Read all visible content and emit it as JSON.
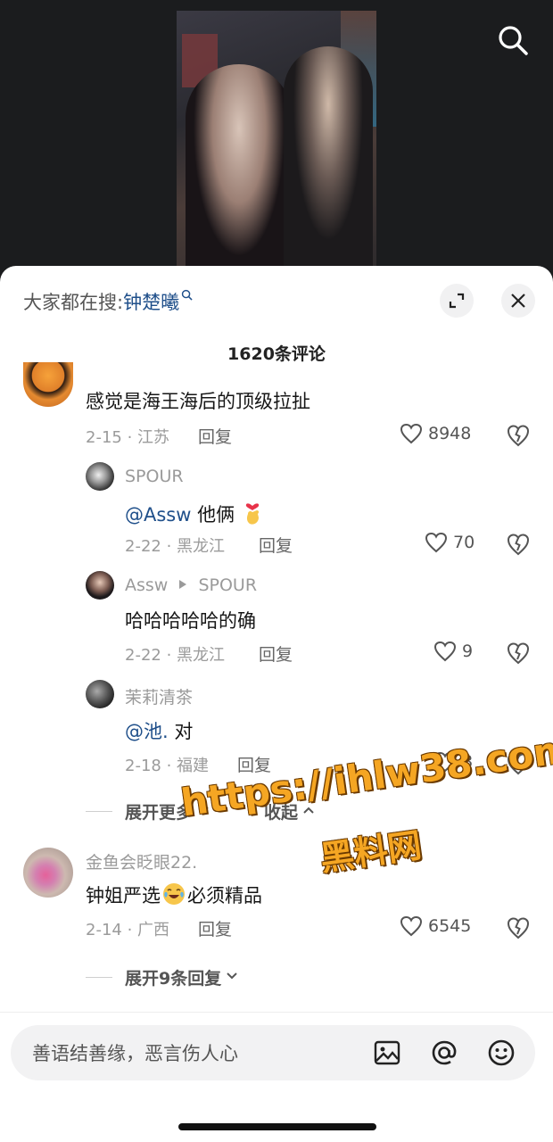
{
  "video": {
    "search_icon": "search-icon"
  },
  "hot_search": {
    "prefix": "大家都在搜:",
    "keyword": "钟楚曦"
  },
  "comment_count": "1620条评论",
  "comments": [
    {
      "user": "",
      "text": "感觉是海王海后的顶级拉扯",
      "meta": "2-15 · 江苏",
      "reply": "回复",
      "likes": "8948"
    },
    {
      "user": "SPOUR",
      "mention": "@Assw",
      "text": " 他俩",
      "meta": "2-22 · 黑龙江",
      "reply": "回复",
      "likes": "70"
    },
    {
      "user": "Assw",
      "reply_to": "SPOUR",
      "text": "哈哈哈哈哈的确",
      "meta": "2-22 · 黑龙江",
      "reply": "回复",
      "likes": "9"
    },
    {
      "user": "茉莉清茶",
      "mention": "@池.",
      "text": " 对",
      "meta": "2-18 · 福建",
      "reply": "回复",
      "likes": "8"
    },
    {
      "user": "金鱼会眨眼22.",
      "text_a": "钟姐严选",
      "text_b": "必须精品",
      "meta": "2-14 · 广西",
      "reply": "回复",
      "likes": "6545"
    }
  ],
  "expand_more": "展开更多",
  "collapse": "收起",
  "expand_replies": "展开9条回复",
  "input": {
    "placeholder": "善语结善缘，恶言伤人心"
  },
  "watermark": {
    "line1": "https://ihlw38.com",
    "line2": "黑料网"
  },
  "colors": {
    "link": "#1f4f8a",
    "watermark": "#f5a623"
  }
}
